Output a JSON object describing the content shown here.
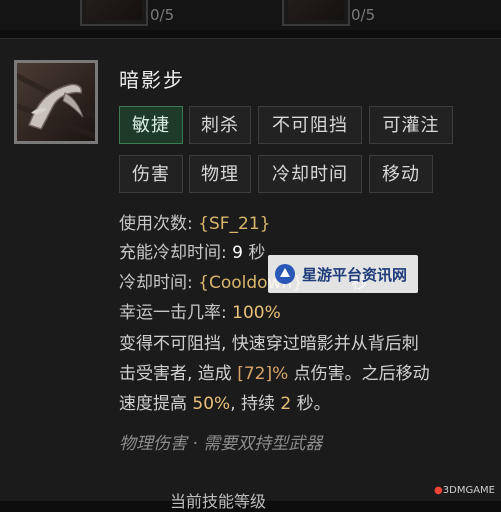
{
  "top_slots": [
    {
      "count": "0/5"
    },
    {
      "count": "0/5"
    }
  ],
  "skill": {
    "name": "暗影步",
    "icon": "shadow-blade-icon"
  },
  "tags_row1": [
    "敏捷",
    "刺杀",
    "不可阻挡",
    "可灌注"
  ],
  "tags_row2": [
    "伤害",
    "物理",
    "冷却时间",
    "移动"
  ],
  "stats": {
    "charges_label": "使用次数: ",
    "charges_value": "{SF_21}",
    "charge_cd_label": "充能冷却时间: ",
    "charge_cd_value": "9",
    "charge_cd_unit": " 秒",
    "cooldown_label": "冷却时间: ",
    "cooldown_value": "{Cooldown}",
    "cooldown_tail": "秒",
    "lucky_label": "幸运一击几率: ",
    "lucky_value": "100%"
  },
  "description": {
    "line1": "变得不可阻挡, 快速穿过暗影并从背后刺",
    "line2_a": "击受害者, 造成 ",
    "line2_pct": "[72]%",
    "line2_b": " 点伤害。之后移动",
    "line3_a": "速度提高 ",
    "line3_speed": "50%",
    "line3_b": ", 持续 ",
    "line3_dur": "2",
    "line3_c": " 秒。"
  },
  "footer": "物理伤害 · 需要双持型武器",
  "bottom_fragment": "当前技能等级",
  "watermark": {
    "text": "星游平台资讯网",
    "corner": "3DMGAME"
  },
  "colors": {
    "active_tag": "#1e3a28",
    "highlight": "#e8c07a"
  }
}
